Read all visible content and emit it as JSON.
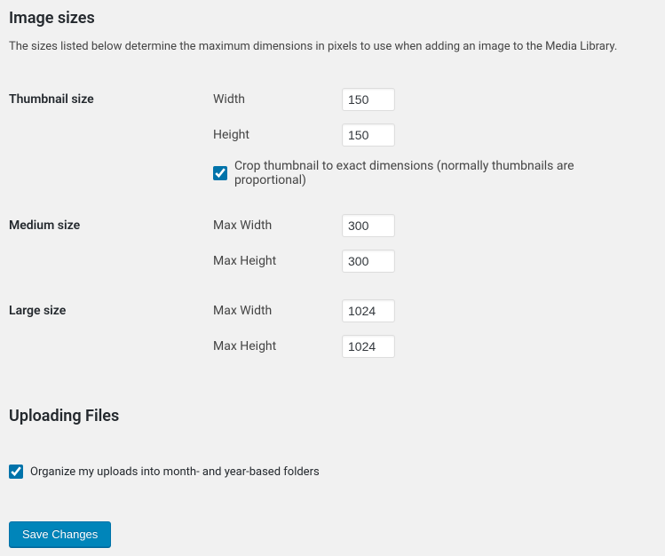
{
  "section_image_sizes": {
    "heading": "Image sizes",
    "description": "The sizes listed below determine the maximum dimensions in pixels to use when adding an image to the Media Library."
  },
  "thumbnail": {
    "row_label": "Thumbnail size",
    "width_label": "Width",
    "width_value": "150",
    "height_label": "Height",
    "height_value": "150",
    "crop_checked": true,
    "crop_label": "Crop thumbnail to exact dimensions (normally thumbnails are proportional)"
  },
  "medium": {
    "row_label": "Medium size",
    "max_width_label": "Max Width",
    "max_width_value": "300",
    "max_height_label": "Max Height",
    "max_height_value": "300"
  },
  "large": {
    "row_label": "Large size",
    "max_width_label": "Max Width",
    "max_width_value": "1024",
    "max_height_label": "Max Height",
    "max_height_value": "1024"
  },
  "uploading": {
    "heading": "Uploading Files",
    "organize_checked": true,
    "organize_label": "Organize my uploads into month- and year-based folders"
  },
  "submit": {
    "label": "Save Changes"
  }
}
